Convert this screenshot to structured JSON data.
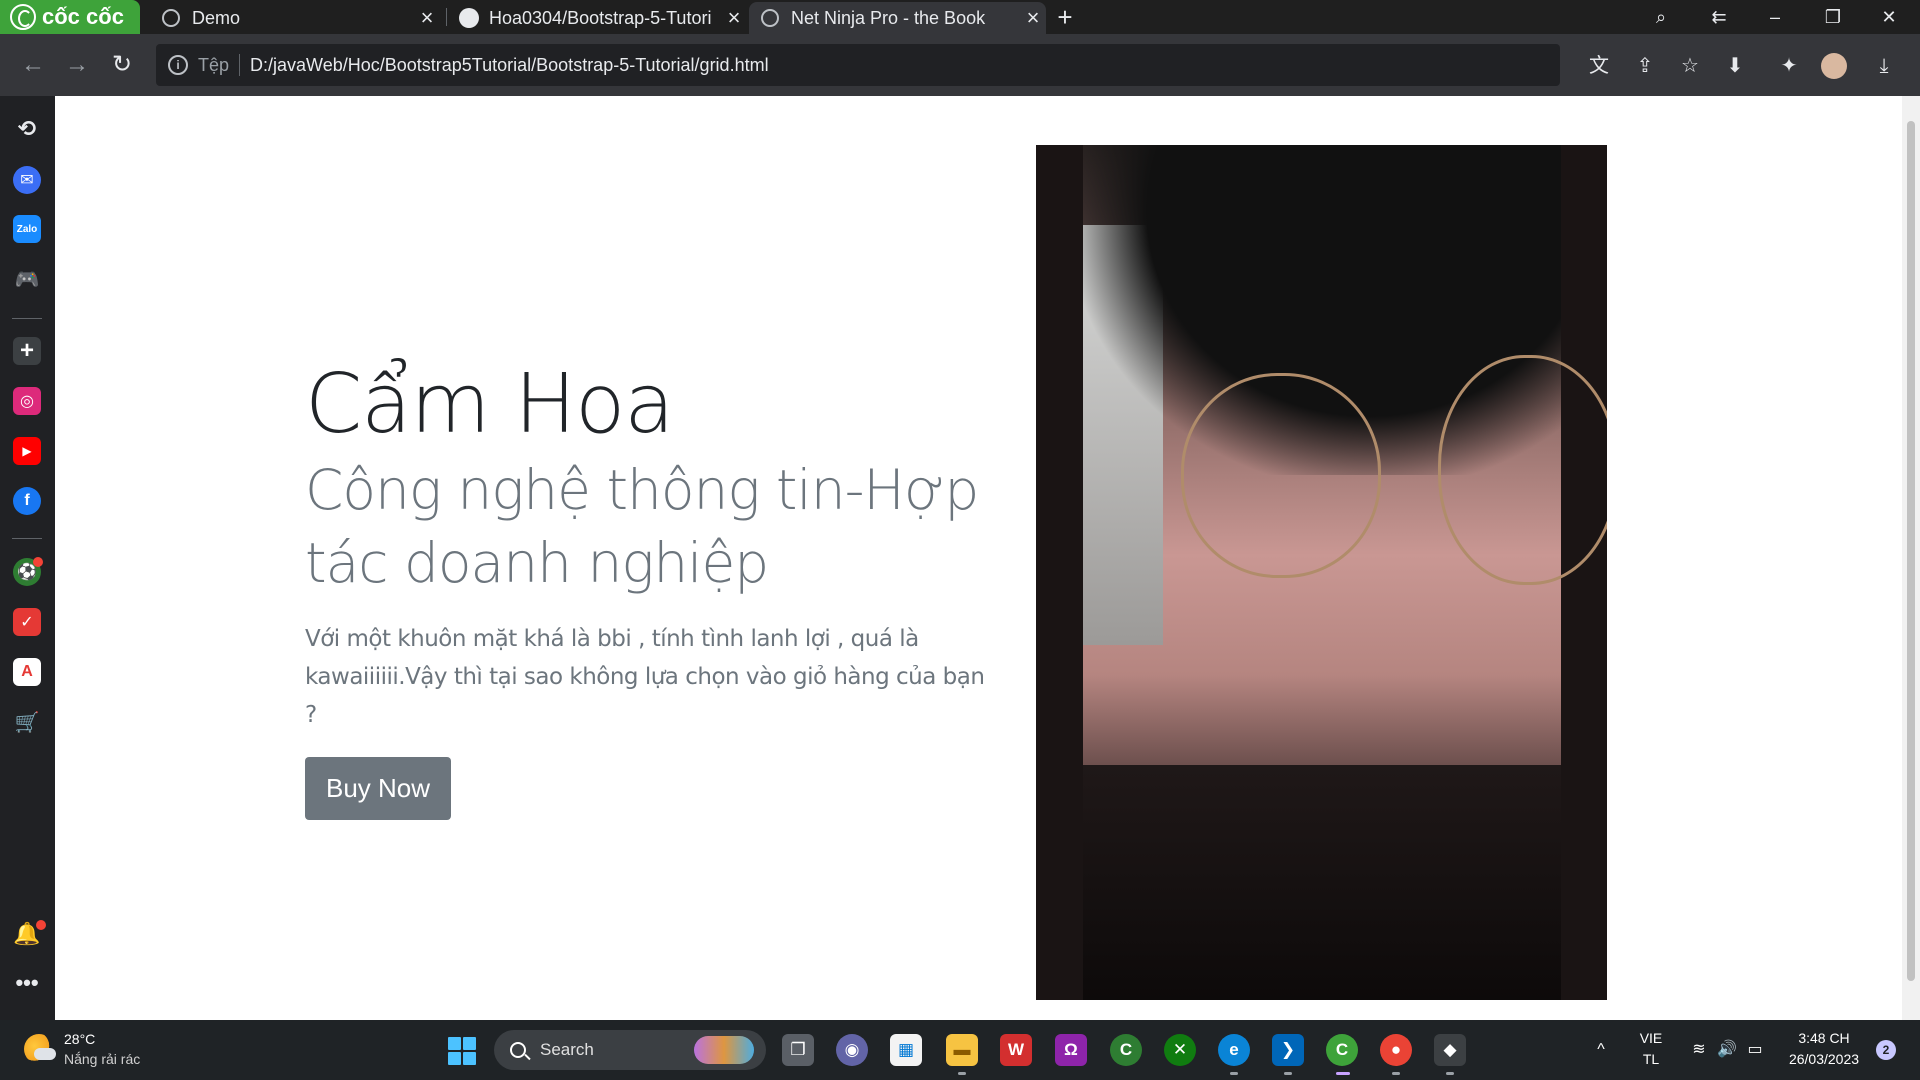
{
  "browser": {
    "brand": "cốc cốc",
    "tabs": [
      {
        "title": "Demo",
        "active": false
      },
      {
        "title": "Hoa0304/Bootstrap-5-Tutori",
        "active": false
      },
      {
        "title": "Net Ninja Pro - the Book",
        "active": true
      }
    ],
    "address": {
      "scheme_label": "Tệp",
      "url": "D:/javaWeb/Hoc/Bootstrap5Tutorial/Bootstrap-5-Tutorial/grid.html"
    }
  },
  "page": {
    "name": "Cẩm Hoa",
    "subtitle": "Công nghệ thông tin-Hợp tác doanh nghiệp",
    "lead": "Với một khuôn mặt khá là bbi , tính tình lanh lợi , quá là kawaiiiiii.Vậy thì tại sao không lựa chọn vào giỏ hàng của bạn ?",
    "button_label": "Buy Now",
    "colors": {
      "button_bg": "#6c757d",
      "heading": "#212529",
      "muted": "#6c757d"
    }
  },
  "taskbar": {
    "weather_temp": "28°C",
    "weather_desc": "Nắng rải rác",
    "search_label": "Search",
    "language_top": "VIE",
    "language_bottom": "TL",
    "time": "3:48 CH",
    "date": "26/03/2023",
    "notification_count": "2"
  }
}
